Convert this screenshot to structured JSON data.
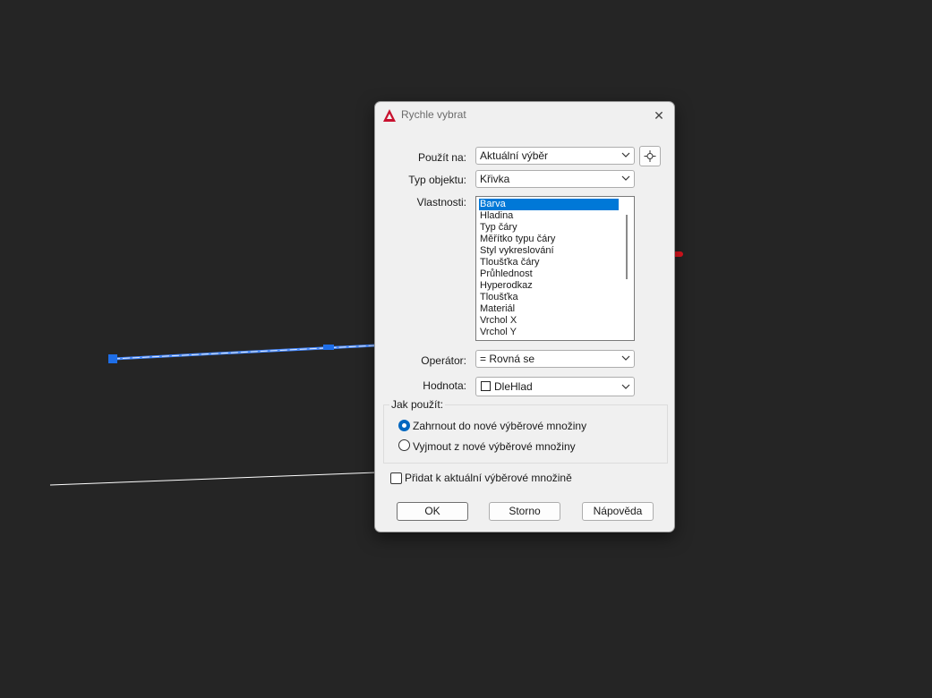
{
  "dialog": {
    "title": "Rychle vybrat",
    "close_glyph": "✕",
    "apply_to": {
      "label": "Použít na:",
      "value": "Aktuální výběr"
    },
    "object_type": {
      "label": "Typ objektu:",
      "value": "Křivka"
    },
    "properties": {
      "label": "Vlastnosti:",
      "items": [
        "Barva",
        "Hladina",
        "Typ čáry",
        "Měřítko typu čáry",
        "Styl vykreslování",
        "Tloušťka čáry",
        "Průhlednost",
        "Hyperodkaz",
        "Tloušťka",
        "Materiál",
        "Vrchol X",
        "Vrchol Y"
      ],
      "selected_index": 0
    },
    "operator": {
      "label": "Operátor:",
      "value": "= Rovná se"
    },
    "value": {
      "label": "Hodnota:",
      "value": "DleHlad",
      "swatch_color": "#ffffff"
    },
    "how_to_apply": {
      "title": "Jak použít:",
      "options": [
        "Zahrnout do nové výběrové množiny",
        "Vyjmout z nové výběrové množiny"
      ],
      "selected_index": 0
    },
    "append_checkbox": {
      "label": "Přidat k aktuální výběrové množině",
      "checked": false
    },
    "buttons": {
      "ok": "OK",
      "cancel": "Storno",
      "help": "Nápověda"
    }
  },
  "colors": {
    "background": "#252525",
    "selection": "#0078d7",
    "annotation": "#e0141e",
    "line_selected": "#4a8cff",
    "line_plain": "#ffffff"
  },
  "icons": [
    "autocad-logo-icon",
    "close-icon",
    "chevron-down-icon",
    "pick-objects-icon"
  ]
}
